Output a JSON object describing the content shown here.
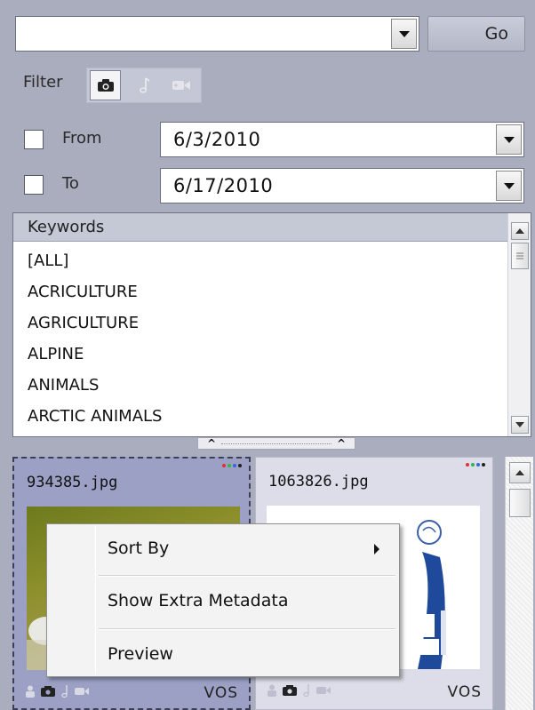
{
  "search": {
    "value": "",
    "go_label": "Go"
  },
  "filter": {
    "label": "Filter",
    "buttons": [
      {
        "icon": "camera-icon",
        "active": true
      },
      {
        "icon": "music-note-icon",
        "active": false
      },
      {
        "icon": "video-camera-icon",
        "active": false
      }
    ]
  },
  "dates": {
    "from": {
      "label": "From",
      "value": "6/3/2010",
      "checked": false
    },
    "to": {
      "label": "To",
      "value": "6/17/2010",
      "checked": false
    }
  },
  "keywords": {
    "header": "Keywords",
    "items": [
      "[ALL]",
      "ACRICULTURE",
      "AGRICULTURE",
      "ALPINE",
      "ANIMALS",
      "ARCTIC ANIMALS"
    ]
  },
  "thumbnails": [
    {
      "name": "934385.jpg",
      "badge": "VOS",
      "selected": true,
      "dot_colors": [
        "#e0303a",
        "#38b24a",
        "#3a67d8",
        "#222222"
      ]
    },
    {
      "name": "1063826.jpg",
      "badge": "VOS",
      "selected": false,
      "dot_colors": [
        "#e0303a",
        "#38b24a",
        "#3a67d8",
        "#222222"
      ]
    }
  ],
  "context_menu": {
    "items": [
      {
        "label": "Sort By",
        "has_submenu": true
      },
      {
        "label": "Show Extra Metadata",
        "has_submenu": false
      },
      {
        "label": "Preview",
        "has_submenu": false
      }
    ]
  },
  "colors": {
    "panel_bg": "#a9adbe",
    "selection": "#9ba0c4"
  }
}
